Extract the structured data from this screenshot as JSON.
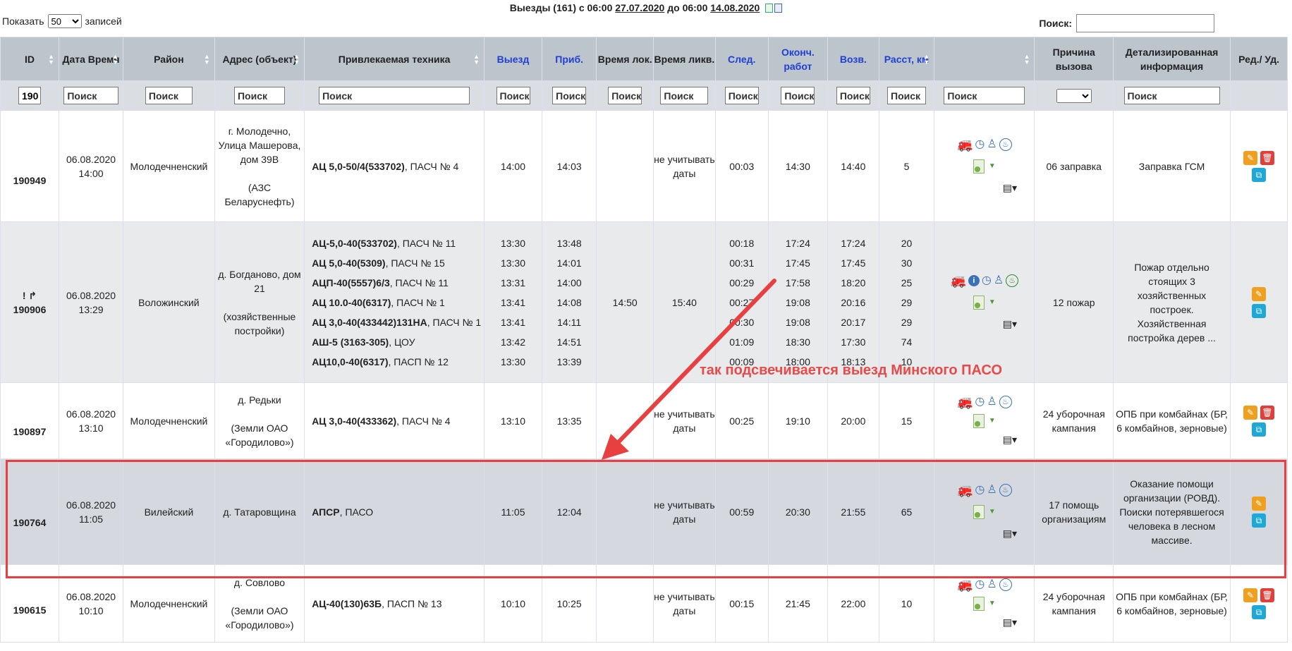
{
  "header": {
    "show_label": "Показать",
    "show_value": "50",
    "show_suffix": "записей",
    "title_prefix": "Выезды (161) с 06:00",
    "date_from": "27.07.2020",
    "title_mid": "до 06:00",
    "date_to": "14.08.2020",
    "search_label": "Поиск:",
    "search_value": ""
  },
  "columns": [
    {
      "label": "ID"
    },
    {
      "label": "Дата Время"
    },
    {
      "label": "Район"
    },
    {
      "label": "Адрес (объект)"
    },
    {
      "label": "Привлекаемая техника"
    },
    {
      "label": "Выезд"
    },
    {
      "label": "Приб."
    },
    {
      "label": "Время лок."
    },
    {
      "label": "Время ликв."
    },
    {
      "label": "След."
    },
    {
      "label": "Оконч. работ"
    },
    {
      "label": "Возв."
    },
    {
      "label": "Расст, км"
    },
    {
      "label": ""
    },
    {
      "label": "Причина вызова"
    },
    {
      "label": "Детализированная информация"
    },
    {
      "label": "Ред./ Уд."
    }
  ],
  "filters": {
    "id_value": "190",
    "placeholder": "Поиск"
  },
  "rows": [
    {
      "id": "190949",
      "prefix": "",
      "date": "06.08.2020",
      "time": "14:00",
      "district": "Молодечненский",
      "address": "г. Молодечно, Улица Машерова, дом 39В",
      "object": "(АЗС Беларуснефть)",
      "tech_bold": "АЦ 5,0-50/4(533702)",
      "tech_rest": ", ПАСЧ № 4",
      "departure": "14:00",
      "arrival": "14:03",
      "loc": "",
      "liq": "не учитывать даты",
      "follow": "00:03",
      "end": "14:30",
      "return": "14:40",
      "dist": "5",
      "reason": "06 заправка",
      "details": "Заправка ГСМ"
    },
    {
      "id": "190906",
      "prefix": "! ↱",
      "date": "06.08.2020",
      "time": "13:29",
      "district": "Воложинский",
      "address": "д. Богданово, дом 21",
      "object": "(хозяйственные постройки)",
      "tech": [
        {
          "b": "АЦ-5,0-40(533702)",
          "r": ", ПАСЧ № 11"
        },
        {
          "b": "АЦ 5,0-40(5309)",
          "r": ", ПАСЧ № 15"
        },
        {
          "b": "АЦП-40(5557)6/3",
          "r": ", ПАСЧ № 11"
        },
        {
          "b": "АЦ 10.0-40(6317)",
          "r": ", ПАСЧ № 1"
        },
        {
          "b": "АЦ 3,0-40(433442)131НА",
          "r": ", ПАСЧ № 1"
        },
        {
          "b": "АШ-5 (3163-305)",
          "r": ", ЦОУ"
        },
        {
          "b": "АЦ10,0-40(6317)",
          "r": ", ПАСП № 12"
        }
      ],
      "departures": [
        "13:30",
        "13:30",
        "13:31",
        "13:41",
        "13:41",
        "13:42",
        "13:30"
      ],
      "arrivals": [
        "13:48",
        "14:01",
        "14:00",
        "14:08",
        "14:11",
        "14:51",
        "13:39"
      ],
      "loc": "14:50",
      "liq": "15:40",
      "follows": [
        "00:18",
        "00:31",
        "00:29",
        "00:27",
        "00:30",
        "01:09",
        "00:09"
      ],
      "ends": [
        "17:24",
        "17:45",
        "17:58",
        "19:08",
        "19:08",
        "18:30",
        "18:00"
      ],
      "returns": [
        "17:24",
        "17:45",
        "18:20",
        "20:16",
        "20:17",
        "17:30",
        "18:13"
      ],
      "dists": [
        "20",
        "30",
        "25",
        "29",
        "29",
        "74",
        "10"
      ],
      "reason": "12 пожар",
      "details": "Пожар отдельно стоящих 3 хозяйственных построек. Хозяйственная постройка дерев ..."
    },
    {
      "id": "190897",
      "prefix": "",
      "date": "06.08.2020",
      "time": "13:10",
      "district": "Молодечненский",
      "address": "д. Редьки",
      "object": "(Земли ОАО «Городилово»)",
      "tech_bold": "АЦ 3,0-40(433362)",
      "tech_rest": ", ПАСЧ № 4",
      "departure": "13:10",
      "arrival": "13:35",
      "loc": "",
      "liq": "не учитывать даты",
      "follow": "00:25",
      "end": "19:10",
      "return": "20:00",
      "dist": "15",
      "reason": "24 уборочная кампания",
      "details": "ОПБ при комбайнах (БР, 6 комбайнов, зерновые)"
    },
    {
      "id": "190764",
      "prefix": "",
      "date": "06.08.2020",
      "time": "11:05",
      "district": "Вилейский",
      "address": "д. Татаровщина",
      "object": "",
      "tech_bold": "АПСР",
      "tech_rest": ", ПАСО",
      "departure": "11:05",
      "arrival": "12:04",
      "loc": "",
      "liq": "не учитывать даты",
      "follow": "00:59",
      "end": "20:30",
      "return": "21:55",
      "dist": "65",
      "reason": "17 помощь организациям",
      "details": "Оказание помощи организации (РОВД). Поиски потерявшегося человека в лесном массиве."
    },
    {
      "id": "190615",
      "prefix": "",
      "date": "06.08.2020",
      "time": "10:10",
      "district": "Молодечненский",
      "address": "д. Совлово",
      "object": "(Земли ОАО «Городилово»)",
      "tech_bold": "АЦ-40(130)63Б",
      "tech_rest": ", ПАСП № 13",
      "departure": "10:10",
      "arrival": "10:25",
      "loc": "",
      "liq": "не учитывать даты",
      "follow": "00:15",
      "end": "21:45",
      "return": "22:00",
      "dist": "10",
      "reason": "24 уборочная кампания",
      "details": "ОПБ при комбайнах (БР, 6 комбайнов, зерновые)"
    }
  ],
  "annotation": {
    "text": "так подсвечивается выезд Минского ПАСО",
    "color": "#e84040"
  },
  "icons": [
    "car-icon",
    "clock-icon",
    "person-icon",
    "fire-icon",
    "info-icon",
    "document-icon",
    "sheet-icon",
    "edit-icon",
    "delete-icon",
    "copy-icon"
  ]
}
